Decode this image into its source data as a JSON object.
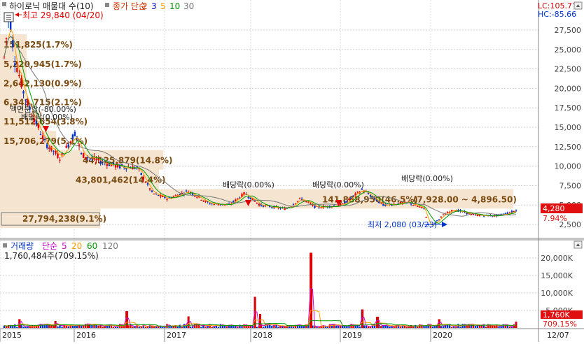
{
  "legend": {
    "title": "하이로닉 매물대 수(10)",
    "ma_prefix": "종가 단순",
    "ma_periods": [
      "2",
      "3",
      "5",
      "10",
      "30"
    ],
    "ma_colors": [
      "#cc3300",
      "#0000cc",
      "#ff9900",
      "#009900",
      "#777777"
    ]
  },
  "top_right": {
    "lc": "LC:105.77",
    "hc": "HC:-85.66"
  },
  "annotations": {
    "high": "최고 29,840 (04/20)",
    "low": "최저 2,080 (03/23)",
    "split": "액면분할(-80.00%)",
    "dividend": "배당락(0.00%)"
  },
  "price_badges": {
    "current": "4,280",
    "change": "7.94%"
  },
  "volume_badges": {
    "current": "1,760K",
    "change": "709.15%"
  },
  "volume_legend": {
    "title": "거래량",
    "ma_prefix": "단순",
    "ma_periods": [
      "5",
      "20",
      "60",
      "120"
    ],
    "ma_colors": [
      "#cc00cc",
      "#ff9900",
      "#009900",
      "#777777"
    ],
    "value": "1,760,484주(709.15%)"
  },
  "x_axis_extra": "12/07",
  "colors": {
    "up": "#e00000",
    "down": "#0033cc",
    "profile_fill": "#f5e4cf",
    "profile_text": "#7a4a10",
    "badge_red": "#e01010",
    "axis_text": "#444444"
  },
  "chart_data": [
    {
      "type": "candlestick",
      "title": "하이로닉 매물대 수(10)",
      "x_categories": [
        "2015",
        "2016",
        "2017",
        "2018",
        "2019",
        "2020",
        "12/07"
      ],
      "y_ticks": [
        2500,
        5000,
        7500,
        10000,
        12500,
        15000,
        17500,
        20000,
        22500,
        25000,
        27500
      ],
      "y_tick_labels": [
        "2,500",
        "5,000",
        "7,500",
        "10,000",
        "12,500",
        "15,000",
        "17,500",
        "20,000",
        "22,500",
        "25,000",
        "27,500"
      ],
      "ylim": [
        1000,
        30000
      ],
      "grid": true,
      "volume_profile": [
        {
          "label": "151,825(1.7%)",
          "price": 25700,
          "share": 1.7
        },
        {
          "label": "5,220,945(1.7%)",
          "price": 23200,
          "share": 1.7
        },
        {
          "label": "2,642,130(0.9%)",
          "price": 20700,
          "share": 0.9
        },
        {
          "label": "6,343,715(2.1%)",
          "price": 18300,
          "share": 2.1
        },
        {
          "label": "11,512,654(3.8%)",
          "price": 15800,
          "share": 3.8
        },
        {
          "label": "15,706,279(5.1%)",
          "price": 13300,
          "share": 5.1
        },
        {
          "label": "44,125,879(14.8%)",
          "price": 10800,
          "share": 14.8
        },
        {
          "label": "43,801,462(14.4%)",
          "price": 8300,
          "share": 14.4
        },
        {
          "label": "141,888,950(46.5%)",
          "price": 5800,
          "share": 46.5
        },
        {
          "label": "27,794,238(9.1%)",
          "price": 3300,
          "share": 9.1
        }
      ],
      "price_range_label": "7,928.00 ~ 4,896.50",
      "price_path_key": [
        {
          "t": 0.0,
          "p": 24000
        },
        {
          "t": 0.01,
          "p": 29840
        },
        {
          "t": 0.02,
          "p": 24000
        },
        {
          "t": 0.04,
          "p": 19000
        },
        {
          "t": 0.06,
          "p": 16000
        },
        {
          "t": 0.08,
          "p": 13000
        },
        {
          "t": 0.11,
          "p": 11000
        },
        {
          "t": 0.14,
          "p": 14500
        },
        {
          "t": 0.15,
          "p": 11500
        },
        {
          "t": 0.18,
          "p": 10800
        },
        {
          "t": 0.22,
          "p": 10000
        },
        {
          "t": 0.26,
          "p": 9800
        },
        {
          "t": 0.29,
          "p": 6500
        },
        {
          "t": 0.32,
          "p": 5800
        },
        {
          "t": 0.36,
          "p": 6800
        },
        {
          "t": 0.4,
          "p": 5200
        },
        {
          "t": 0.44,
          "p": 5000
        },
        {
          "t": 0.47,
          "p": 6500
        },
        {
          "t": 0.5,
          "p": 5000
        },
        {
          "t": 0.55,
          "p": 4500
        },
        {
          "t": 0.58,
          "p": 5800
        },
        {
          "t": 0.61,
          "p": 4700
        },
        {
          "t": 0.66,
          "p": 5000
        },
        {
          "t": 0.7,
          "p": 7000
        },
        {
          "t": 0.74,
          "p": 5000
        },
        {
          "t": 0.79,
          "p": 5300
        },
        {
          "t": 0.82,
          "p": 4500
        },
        {
          "t": 0.83,
          "p": 2080
        },
        {
          "t": 0.86,
          "p": 3800
        },
        {
          "t": 0.88,
          "p": 4400
        },
        {
          "t": 0.92,
          "p": 3700
        },
        {
          "t": 0.96,
          "p": 3600
        },
        {
          "t": 0.98,
          "p": 3900
        },
        {
          "t": 1.0,
          "p": 4280
        }
      ]
    },
    {
      "type": "bar",
      "title": "거래량",
      "y_ticks": [
        5000,
        10000,
        15000,
        20000
      ],
      "y_tick_labels": [
        "5,000K",
        "10,000K",
        "15,000K",
        "20,000K"
      ],
      "ylim": [
        0,
        24000
      ],
      "volume_spikes": [
        {
          "t": 0.03,
          "v": 2500
        },
        {
          "t": 0.1,
          "v": 2000
        },
        {
          "t": 0.165,
          "v": 1200
        },
        {
          "t": 0.24,
          "v": 4800
        },
        {
          "t": 0.36,
          "v": 3300
        },
        {
          "t": 0.49,
          "v": 8900
        },
        {
          "t": 0.5,
          "v": 4000
        },
        {
          "t": 0.6,
          "v": 21500
        },
        {
          "t": 0.7,
          "v": 5300
        },
        {
          "t": 0.73,
          "v": 3200
        },
        {
          "t": 0.85,
          "v": 2500
        },
        {
          "t": 1.0,
          "v": 1760
        }
      ]
    }
  ]
}
